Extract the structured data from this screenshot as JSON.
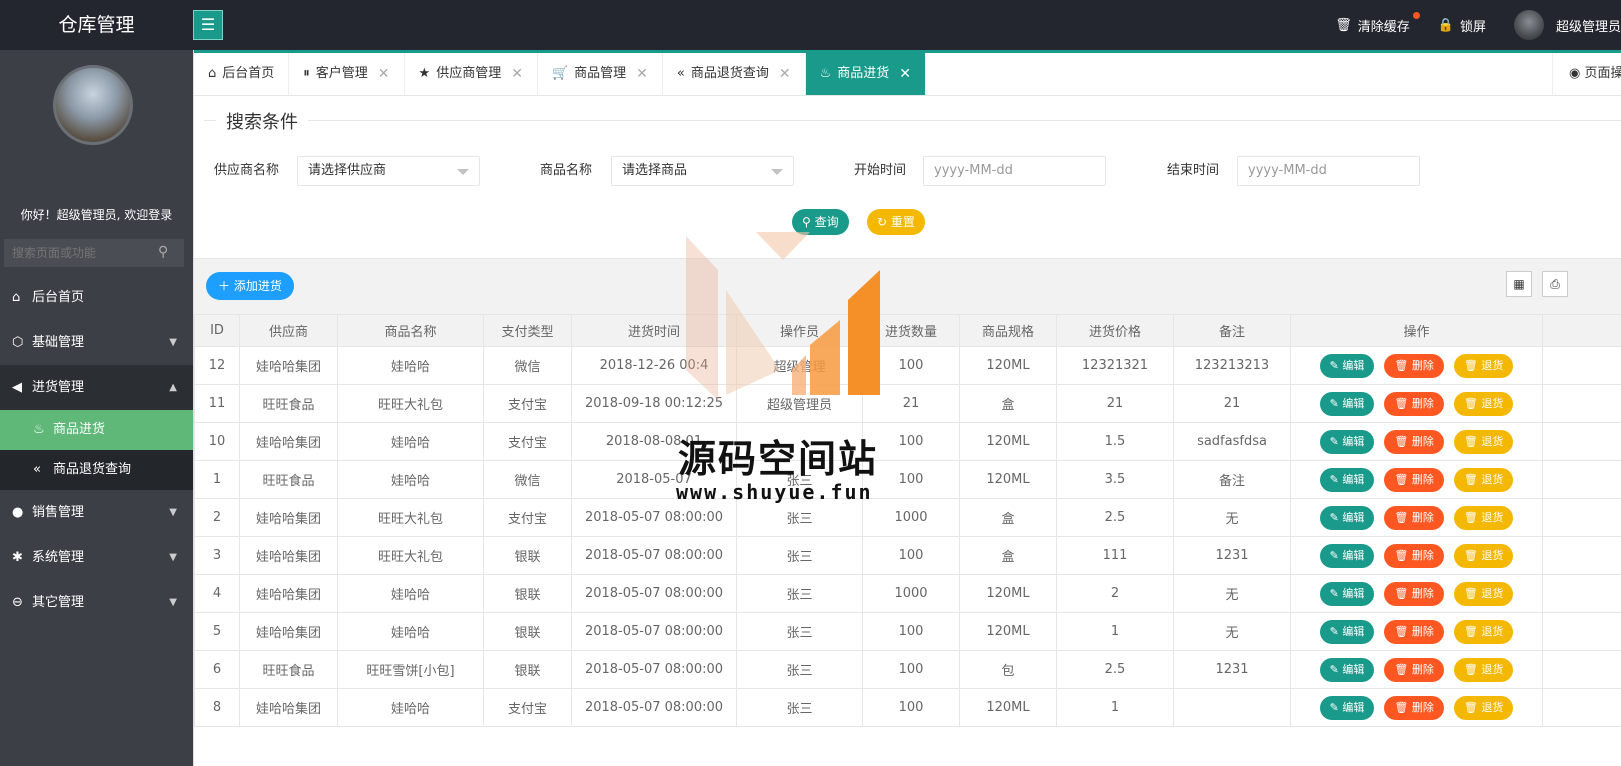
{
  "header": {
    "logo": "仓库管理",
    "clear_cache": "清除缓存",
    "lock_screen": "锁屏",
    "user": "超级管理员"
  },
  "sidebar": {
    "welcome": "你好！超级管理员, 欢迎登录",
    "search_placeholder": "搜索页面或功能",
    "items": [
      {
        "label": "后台首页",
        "icon": "home-icon"
      },
      {
        "label": "基础管理",
        "icon": "cube-icon"
      },
      {
        "label": "进货管理",
        "icon": "volume-icon"
      },
      {
        "label": "商品进货",
        "icon": "fire-icon"
      },
      {
        "label": "商品退货查询",
        "icon": "double-left-icon"
      },
      {
        "label": "销售管理",
        "icon": "chat-icon"
      },
      {
        "label": "系统管理",
        "icon": "gear-icon"
      },
      {
        "label": "其它管理",
        "icon": "circle-arrow-icon"
      }
    ]
  },
  "tabs": [
    {
      "label": "后台首页"
    },
    {
      "label": "客户管理"
    },
    {
      "label": "供应商管理"
    },
    {
      "label": "商品管理"
    },
    {
      "label": "商品退货查询"
    },
    {
      "label": "商品进货"
    }
  ],
  "page_ops": "页面操作",
  "search": {
    "legend": "搜索条件",
    "supplier_label": "供应商名称",
    "supplier_value": "请选择供应商",
    "goods_label": "商品名称",
    "goods_value": "请选择商品",
    "start_label": "开始时间",
    "start_placeholder": "yyyy-MM-dd",
    "end_label": "结束时间",
    "end_placeholder": "yyyy-MM-dd",
    "query_btn": "查询",
    "reset_btn": "重置"
  },
  "toolbar": {
    "add_btn": "添加进货"
  },
  "table": {
    "columns": [
      "ID",
      "供应商",
      "商品名称",
      "支付类型",
      "进货时间",
      "操作员",
      "进货数量",
      "商品规格",
      "进货价格",
      "备注",
      "操作"
    ],
    "actions": {
      "edit": "编辑",
      "delete": "删除",
      "return": "退货"
    },
    "rows": [
      [
        "12",
        "娃哈哈集团",
        "娃哈哈",
        "微信",
        "2018-12-26 00:4",
        "超级管理",
        "100",
        "120ML",
        "12321321",
        "123213213"
      ],
      [
        "11",
        "旺旺食品",
        "旺旺大礼包",
        "支付宝",
        "2018-09-18 00:12:25",
        "超级管理员",
        "21",
        "盒",
        "21",
        "21"
      ],
      [
        "10",
        "娃哈哈集团",
        "娃哈哈",
        "支付宝",
        "2018-08-08 01",
        "",
        "100",
        "120ML",
        "1.5",
        "sadfasfdsa"
      ],
      [
        "1",
        "旺旺食品",
        "娃哈哈",
        "微信",
        "2018-05-07",
        "张三",
        "100",
        "120ML",
        "3.5",
        "备注"
      ],
      [
        "2",
        "娃哈哈集团",
        "旺旺大礼包",
        "支付宝",
        "2018-05-07 08:00:00",
        "张三",
        "1000",
        "盒",
        "2.5",
        "无"
      ],
      [
        "3",
        "娃哈哈集团",
        "旺旺大礼包",
        "银联",
        "2018-05-07 08:00:00",
        "张三",
        "100",
        "盒",
        "111",
        "1231"
      ],
      [
        "4",
        "娃哈哈集团",
        "娃哈哈",
        "银联",
        "2018-05-07 08:00:00",
        "张三",
        "1000",
        "120ML",
        "2",
        "无"
      ],
      [
        "5",
        "娃哈哈集团",
        "娃哈哈",
        "银联",
        "2018-05-07 08:00:00",
        "张三",
        "100",
        "120ML",
        "1",
        "无"
      ],
      [
        "6",
        "旺旺食品",
        "旺旺雪饼[小包]",
        "银联",
        "2018-05-07 08:00:00",
        "张三",
        "100",
        "包",
        "2.5",
        "1231"
      ],
      [
        "8",
        "娃哈哈集团",
        "娃哈哈",
        "支付宝",
        "2018-05-07 08:00:00",
        "张三",
        "100",
        "120ML",
        "1",
        ""
      ]
    ]
  },
  "watermark": {
    "title": "源码空间站",
    "url": "www.shuyue.fun"
  },
  "colors": {
    "header_bg": "#23262e",
    "sidebar_bg": "#3c3f45",
    "accent": "#1a9a8a",
    "active_sub": "#5fb878",
    "danger": "#ff5722",
    "warn": "#f5b800",
    "primary": "#1e9fff"
  }
}
